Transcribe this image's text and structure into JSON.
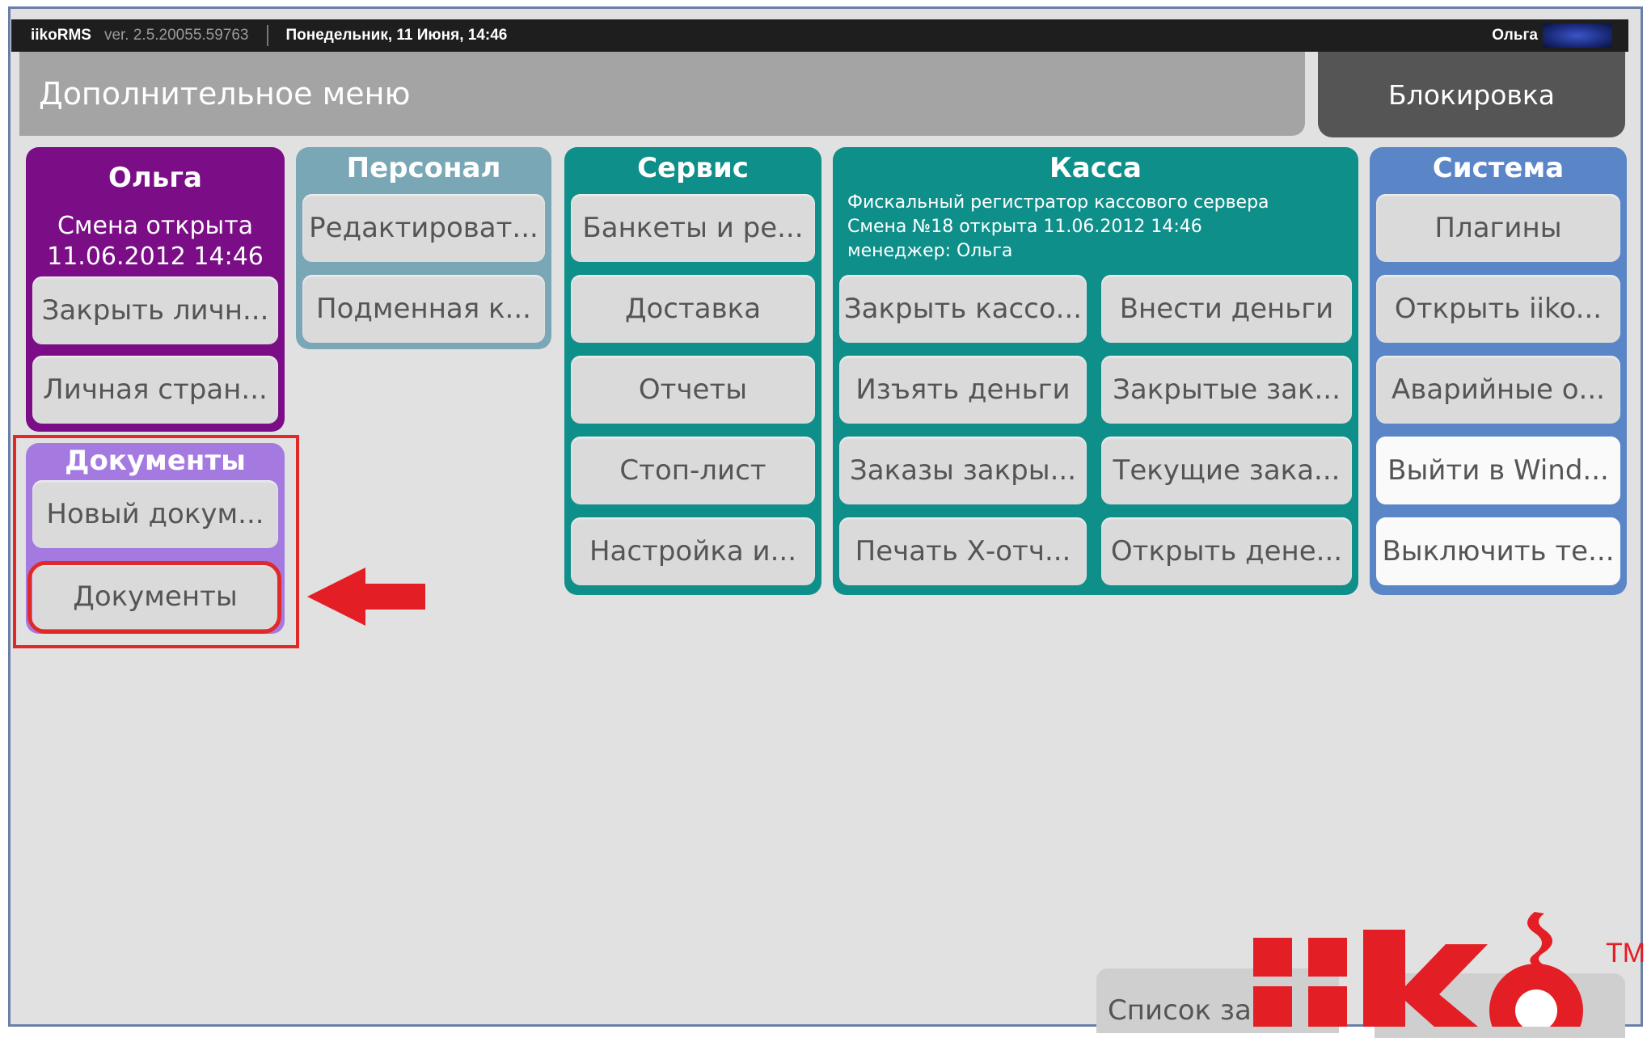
{
  "topbar": {
    "app_name": "iikoRMS",
    "version": "ver. 2.5.20055.59763",
    "datetime": "Понедельник, 11 Июня, 14:46",
    "user": "Ольга"
  },
  "header": {
    "title": "Дополнительное меню",
    "lock_button": "Блокировка"
  },
  "olga_panel": {
    "title": "Ольга",
    "shift_status": "Смена открыта",
    "shift_time": "11.06.2012 14:46",
    "buttons": [
      "Закрыть личн...",
      "Личная стран..."
    ]
  },
  "docs_panel": {
    "title": "Документы",
    "buttons": [
      "Новый докум...",
      "Документы"
    ]
  },
  "staff_panel": {
    "title": "Персонал",
    "buttons": [
      "Редактироват...",
      "Подменная к..."
    ]
  },
  "service_panel": {
    "title": "Сервис",
    "buttons": [
      "Банкеты и ре...",
      "Доставка",
      "Отчеты",
      "Стоп-лист",
      "Настройка и..."
    ]
  },
  "kassa_panel": {
    "title": "Касса",
    "info_line1": "Фискальный регистратор кассового сервера",
    "info_line2": "Смена №18 открыта 11.06.2012 14:46",
    "info_line3": "менеджер: Ольга",
    "buttons_left": [
      "Закрыть кассо...",
      "Изъять деньги",
      "Заказы закры...",
      "Печать Х-отч..."
    ],
    "buttons_right": [
      "Внести деньги",
      "Закрытые зак...",
      "Текущие зака...",
      "Открыть дене..."
    ]
  },
  "system_panel": {
    "title": "Система",
    "buttons": [
      "Плагины",
      "Открыть iiko...",
      "Аварийные о...",
      "Выйти в Wind...",
      "Выключить те..."
    ]
  },
  "bottom": {
    "order_list_label": "Список за"
  },
  "logo": {
    "text": "iiko",
    "trademark": "TM",
    "color": "#e31e24"
  },
  "colors": {
    "olga": "#7b0e86",
    "documents": "#a57ae0",
    "staff": "#7aa7b6",
    "service": "#0e8f8a",
    "kassa": "#0e8f8a",
    "system": "#5a86c8",
    "highlight": "#e02a2a"
  }
}
